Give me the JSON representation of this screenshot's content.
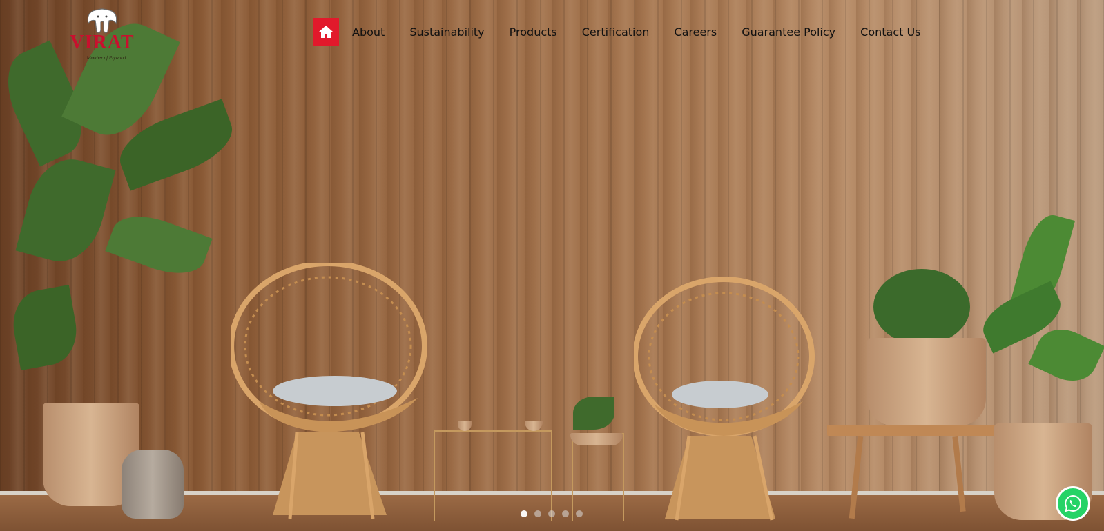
{
  "brand": {
    "name": "VIRAT",
    "tagline": "Member of Plywood",
    "logo_icon": "elephant-icon",
    "accent_color": "#e2192b"
  },
  "nav": {
    "home_icon": "home-icon",
    "items": [
      {
        "label": "About"
      },
      {
        "label": "Sustainability"
      },
      {
        "label": "Products"
      },
      {
        "label": "Certification"
      },
      {
        "label": "Careers"
      },
      {
        "label": "Guarantee Policy"
      },
      {
        "label": "Contact Us"
      }
    ]
  },
  "hero": {
    "slides_count": 5,
    "active_slide": 1
  },
  "floating": {
    "whatsapp_icon": "whatsapp-icon",
    "whatsapp_color": "#25d366"
  }
}
